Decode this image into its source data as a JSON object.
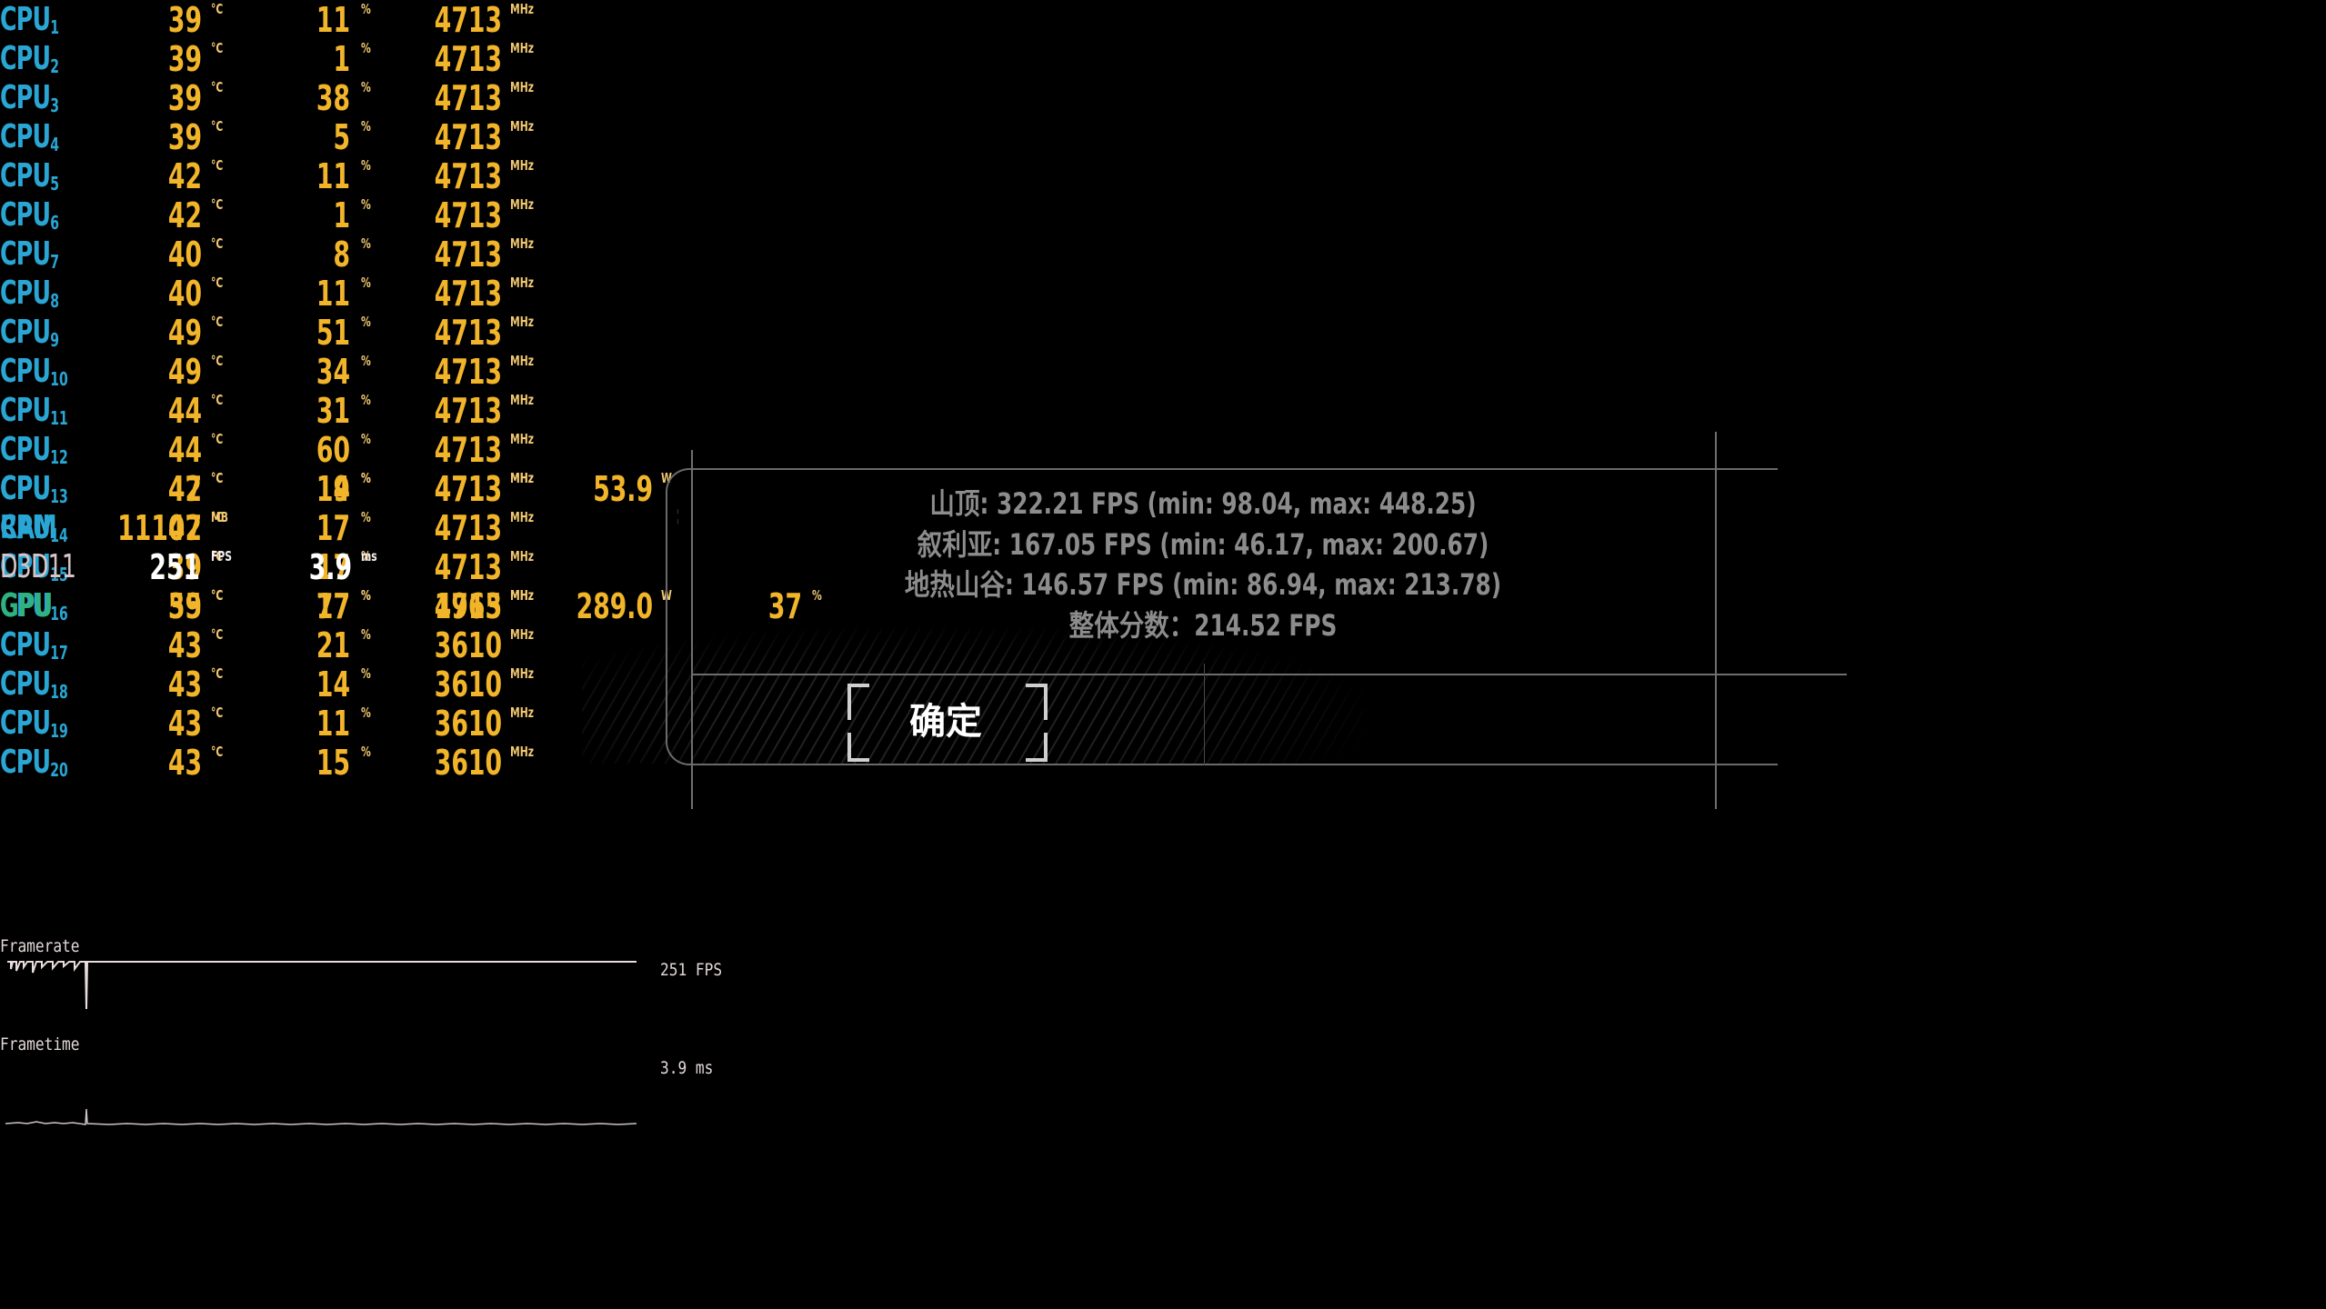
{
  "osd": {
    "cpu_cores": [
      {
        "label": "CPU",
        "index": "1",
        "temp": "39",
        "usage": "11",
        "clock": "4713"
      },
      {
        "label": "CPU",
        "index": "2",
        "temp": "39",
        "usage": "1",
        "clock": "4713"
      },
      {
        "label": "CPU",
        "index": "3",
        "temp": "39",
        "usage": "38",
        "clock": "4713"
      },
      {
        "label": "CPU",
        "index": "4",
        "temp": "39",
        "usage": "5",
        "clock": "4713"
      },
      {
        "label": "CPU",
        "index": "5",
        "temp": "42",
        "usage": "11",
        "clock": "4713"
      },
      {
        "label": "CPU",
        "index": "6",
        "temp": "42",
        "usage": "1",
        "clock": "4713"
      },
      {
        "label": "CPU",
        "index": "7",
        "temp": "40",
        "usage": "8",
        "clock": "4713"
      },
      {
        "label": "CPU",
        "index": "8",
        "temp": "40",
        "usage": "11",
        "clock": "4713"
      },
      {
        "label": "CPU",
        "index": "9",
        "temp": "49",
        "usage": "51",
        "clock": "4713"
      },
      {
        "label": "CPU",
        "index": "10",
        "temp": "49",
        "usage": "34",
        "clock": "4713"
      },
      {
        "label": "CPU",
        "index": "11",
        "temp": "44",
        "usage": "31",
        "clock": "4713"
      },
      {
        "label": "CPU",
        "index": "12",
        "temp": "44",
        "usage": "60",
        "clock": "4713"
      },
      {
        "label": "CPU",
        "index": "13",
        "temp": "42",
        "usage": "14",
        "clock": "4713"
      },
      {
        "label": "CPU",
        "index": "14",
        "temp": "42",
        "usage": "17",
        "clock": "4713"
      },
      {
        "label": "CPU",
        "index": "15",
        "temp": "39",
        "usage": "17",
        "clock": "4713"
      },
      {
        "label": "CPU",
        "index": "16",
        "temp": "39",
        "usage": "17",
        "clock": "4713"
      },
      {
        "label": "CPU",
        "index": "17",
        "temp": "43",
        "usage": "21",
        "clock": "3610"
      },
      {
        "label": "CPU",
        "index": "18",
        "temp": "43",
        "usage": "14",
        "clock": "3610"
      },
      {
        "label": "CPU",
        "index": "19",
        "temp": "43",
        "usage": "11",
        "clock": "3610"
      },
      {
        "label": "CPU",
        "index": "20",
        "temp": "43",
        "usage": "15",
        "clock": "3610"
      }
    ],
    "units": {
      "temp": "°C",
      "usage": "%",
      "clock": "MHz",
      "power": "W",
      "memory": "MB",
      "fps": "FPS",
      "ms": "ms"
    },
    "cpu_total": {
      "label": "CPU",
      "temp": "47",
      "usage": "19",
      "clock": "4713",
      "power": "53.9"
    },
    "ram": {
      "label": "RAM",
      "used": "11107"
    },
    "d3d": {
      "label": "D3D11",
      "fps": "251",
      "frametime": "3.9"
    },
    "gpu": {
      "label": "GPU",
      "temp": "55",
      "usage": "77",
      "clock": "1965",
      "power": "289.0",
      "mem_usage": "37"
    },
    "graphs": {
      "framerate": {
        "label": "Framerate",
        "readout": "251 FPS"
      },
      "frametime": {
        "label": "Frametime",
        "readout": "3.9 ms"
      }
    },
    "colors": {
      "cpu": "#2aa6d4",
      "gpu": "#2fb37e",
      "value": "#f2b52a",
      "d3d": "#d9c3c5"
    }
  },
  "dialog": {
    "results": [
      "山顶: 322.21 FPS (min: 98.04, max: 448.25)",
      "叙利亚: 167.05 FPS (min: 46.17, max: 200.67)",
      "地热山谷: 146.57 FPS (min: 86.94, max: 213.78)",
      "整体分数：214.52 FPS"
    ],
    "confirm_label": "确定"
  }
}
